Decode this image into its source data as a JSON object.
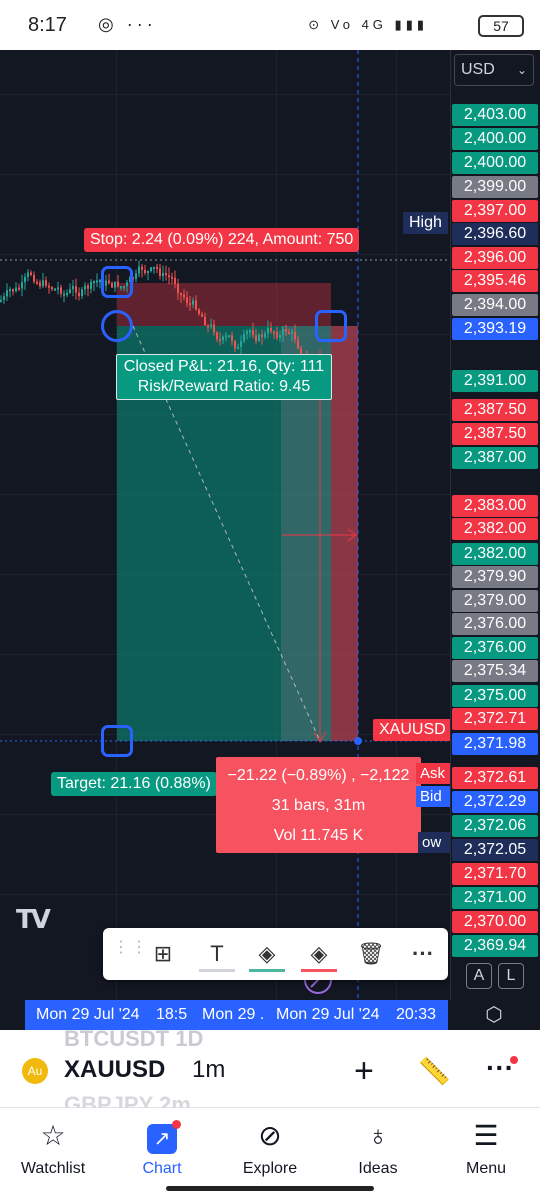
{
  "status_bar": {
    "time": "8:17",
    "left_icons": "◎ ···",
    "right_icons": "⊙ Vo 4G ▮▮▮",
    "battery": "57"
  },
  "currency": {
    "selected": "USD"
  },
  "price_axis": [
    {
      "value": "2,403.00",
      "color": "g"
    },
    {
      "value": "2,400.00",
      "color": "g"
    },
    {
      "value": "2,400.00",
      "color": "g"
    },
    {
      "value": "2,399.00",
      "color": "gr"
    },
    {
      "value": "2,397.00",
      "color": "r"
    },
    {
      "value": "2,396.60",
      "color": "n"
    },
    {
      "value": "2,396.00",
      "color": "r"
    },
    {
      "value": "2,395.46",
      "color": "r"
    },
    {
      "value": "2,394.00",
      "color": "gr"
    },
    {
      "value": "2,393.19",
      "color": "b"
    },
    {
      "value": "2,391.00",
      "color": "g"
    },
    {
      "value": "2,387.50",
      "color": "r"
    },
    {
      "value": "2,387.50",
      "color": "r"
    },
    {
      "value": "2,387.00",
      "color": "g"
    },
    {
      "value": "2,383.00",
      "color": "r"
    },
    {
      "value": "2,382.00",
      "color": "r"
    },
    {
      "value": "2,382.00",
      "color": "g"
    },
    {
      "value": "2,379.90",
      "color": "gr"
    },
    {
      "value": "2,379.00",
      "color": "gr"
    },
    {
      "value": "2,376.00",
      "color": "gr"
    },
    {
      "value": "2,376.00",
      "color": "g"
    },
    {
      "value": "2,375.34",
      "color": "gr"
    },
    {
      "value": "2,375.00",
      "color": "g"
    },
    {
      "value": "2,372.71",
      "color": "r"
    },
    {
      "value": "2,371.98",
      "color": "b"
    },
    {
      "value": "2,372.61",
      "color": "r"
    },
    {
      "value": "2,372.29",
      "color": "b"
    },
    {
      "value": "2,372.06",
      "color": "g"
    },
    {
      "value": "2,372.05",
      "color": "n"
    },
    {
      "value": "2,371.70",
      "color": "r"
    },
    {
      "value": "2,371.00",
      "color": "g"
    },
    {
      "value": "2,370.00",
      "color": "r"
    },
    {
      "value": "2,369.94",
      "color": "g"
    }
  ],
  "labels": {
    "high": "High",
    "symbol_tag": "XAUUSD",
    "ask": "Ask",
    "bid": "Bid",
    "low": "ow"
  },
  "position": {
    "stop_label": "Stop: 2.24 (0.09%) 224, Amount: 750",
    "pnl_line1": "Closed P&L: 21.16, Qty: 111",
    "pnl_line2": "Risk/Reward Ratio: 9.45",
    "target_label": "Target: 21.16 (0.88%)"
  },
  "measure": {
    "line1": "−21.22 (−0.89%) , −2,122",
    "line2": "31 bars, 31m",
    "line3": "Vol 11.745 K"
  },
  "time_axis": {
    "t1": "Mon 29 Jul '24",
    "t2": "18:5",
    "t3": "Mon 29 .",
    "t4": "Mon 29 Jul '24",
    "t5": "20:33"
  },
  "toolbar_buttons": [
    "A",
    "L"
  ],
  "symbol_bar": {
    "symbol": "XAUUSD",
    "interval": "1m",
    "ghost_above": "BTCUSDT  1D",
    "ghost_below": "GBPJPY  2m"
  },
  "nav": [
    {
      "label": "Watchlist",
      "icon": "star-icon"
    },
    {
      "label": "Chart",
      "icon": "chart-icon"
    },
    {
      "label": "Explore",
      "icon": "compass-icon"
    },
    {
      "label": "Ideas",
      "icon": "lightbulb-icon"
    },
    {
      "label": "Menu",
      "icon": "menu-icon"
    }
  ],
  "colors": {
    "accent": "#2962ff",
    "up": "#089981",
    "down": "#f23645",
    "bg": "#131722"
  }
}
